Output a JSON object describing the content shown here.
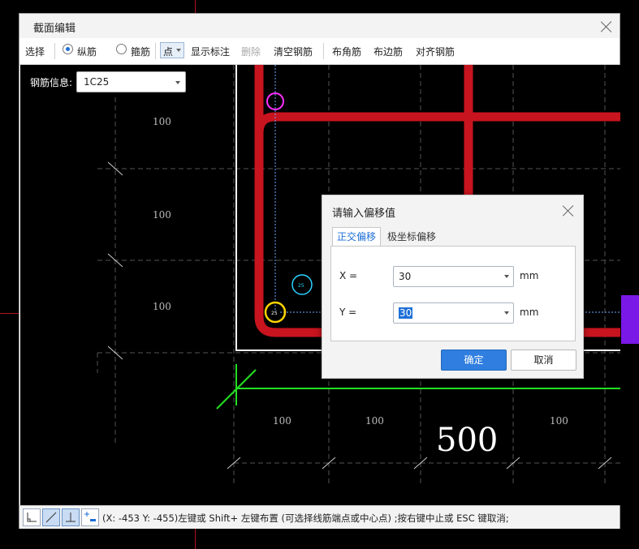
{
  "window": {
    "title": "截面编辑"
  },
  "toolbar": {
    "select": "选择",
    "radio_longitudinal": "纵筋",
    "radio_stirrup": "箍筋",
    "point_mode": "点",
    "show_annotation": "显示标注",
    "delete": "删除",
    "clear_rebar": "清空钢筋",
    "place_corner": "布角筋",
    "place_edge": "布边筋",
    "align_rebar": "对齐钢筋"
  },
  "rebar_info": {
    "label": "钢筋信息:",
    "value": "1C25"
  },
  "canvas": {
    "dim_left": [
      "100",
      "100",
      "100"
    ],
    "dim_bottom": [
      "100",
      "100",
      "100"
    ],
    "dim_main": "500",
    "bar_labels": [
      "25",
      "25"
    ]
  },
  "dialog": {
    "title": "请输入偏移值",
    "tabs": [
      "正交偏移",
      "极坐标偏移"
    ],
    "x_label": "X =",
    "x_value": "30",
    "y_label": "Y =",
    "y_value": "30",
    "unit": "mm",
    "ok": "确定",
    "cancel": "取消"
  },
  "status": {
    "text": "(X: -453 Y: -455)左键或 Shift+ 左键布置 (可选择线筋端点或中心点) ;按右键中止或 ESC 键取消;"
  }
}
